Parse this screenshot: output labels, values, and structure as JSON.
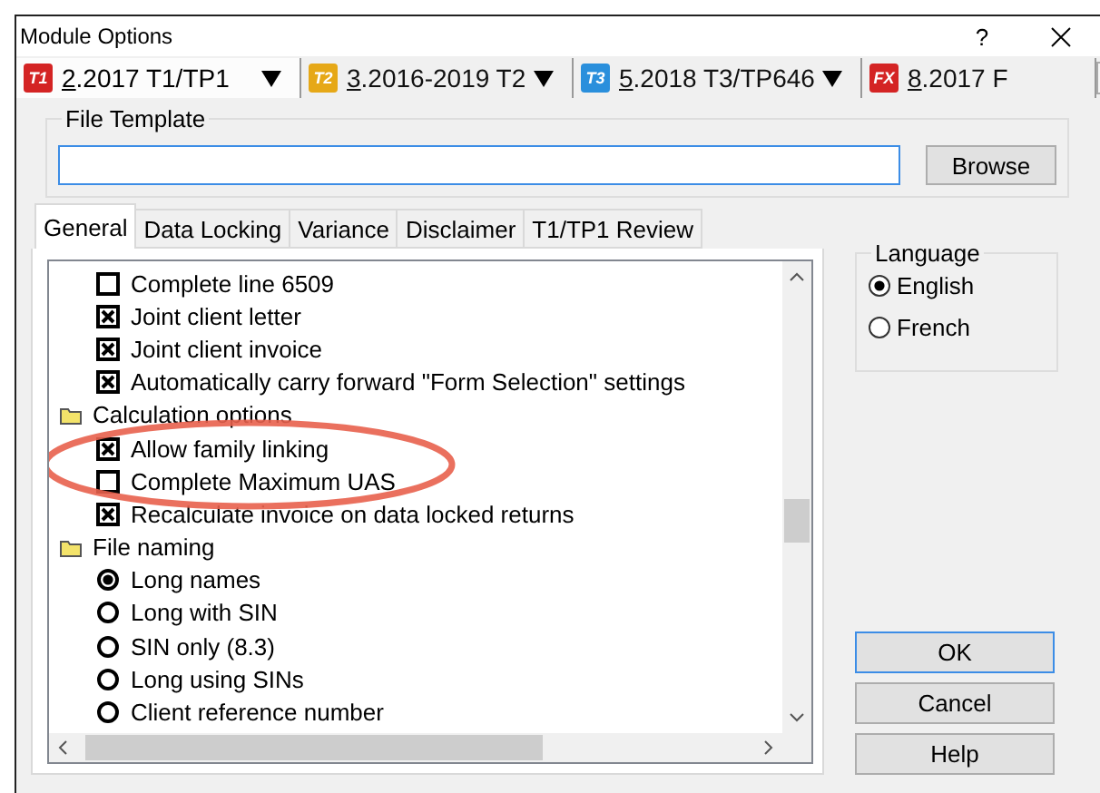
{
  "window": {
    "title": "Module Options",
    "help": "?"
  },
  "module_tabs": [
    {
      "badge": "T1",
      "color": "#d42424",
      "key": "2",
      "label": ".2017 T1/TP1",
      "selected": true
    },
    {
      "badge": "T2",
      "color": "#e6a817",
      "key": "3",
      "label": ".2016-2019 T2",
      "selected": false
    },
    {
      "badge": "T3",
      "color": "#2a8fdc",
      "key": "5",
      "label": ".2018 T3/TP646",
      "selected": false
    },
    {
      "badge": "FX",
      "color": "#d42424",
      "key": "8",
      "label": ".2017 F",
      "selected": false
    }
  ],
  "file_template": {
    "legend": "File Template",
    "browse": "Browse"
  },
  "tabs": [
    {
      "label": "General",
      "selected": true
    },
    {
      "label": "Data Locking",
      "selected": false
    },
    {
      "label": "Variance",
      "selected": false
    },
    {
      "label": "Disclaimer",
      "selected": false
    },
    {
      "label": "T1/TP1 Review",
      "selected": false
    }
  ],
  "tree": {
    "loose_items": [
      {
        "kind": "checkbox",
        "label": "Complete line 6509",
        "checked": false
      },
      {
        "kind": "checkbox",
        "label": "Joint client letter",
        "checked": true
      },
      {
        "kind": "checkbox",
        "label": "Joint client invoice",
        "checked": true
      },
      {
        "kind": "checkbox",
        "label": "Automatically carry forward \"Form Selection\" settings",
        "checked": true
      }
    ],
    "groups": [
      {
        "label": "Calculation options",
        "children": [
          {
            "kind": "checkbox",
            "label": "Allow family linking",
            "checked": true
          },
          {
            "kind": "checkbox",
            "label": "Complete Maximum UAS",
            "checked": false
          },
          {
            "kind": "checkbox",
            "label": "Recalculate invoice on data locked returns",
            "checked": true
          }
        ]
      },
      {
        "label": "File naming",
        "children": [
          {
            "kind": "radio",
            "label": "Long names",
            "checked": true
          },
          {
            "kind": "radio",
            "label": "Long with SIN",
            "checked": false
          },
          {
            "kind": "radio",
            "label": "SIN only (8.3)",
            "checked": false
          },
          {
            "kind": "radio",
            "label": "Long using SINs",
            "checked": false
          },
          {
            "kind": "radio",
            "label": "Client reference number",
            "checked": false
          }
        ]
      }
    ]
  },
  "language": {
    "legend": "Language",
    "options": [
      {
        "label": "English",
        "selected": true
      },
      {
        "label": "French",
        "selected": false
      }
    ]
  },
  "buttons": [
    {
      "label": "OK",
      "default": true
    },
    {
      "label": "Cancel",
      "default": false
    },
    {
      "label": "Help",
      "default": false
    }
  ]
}
